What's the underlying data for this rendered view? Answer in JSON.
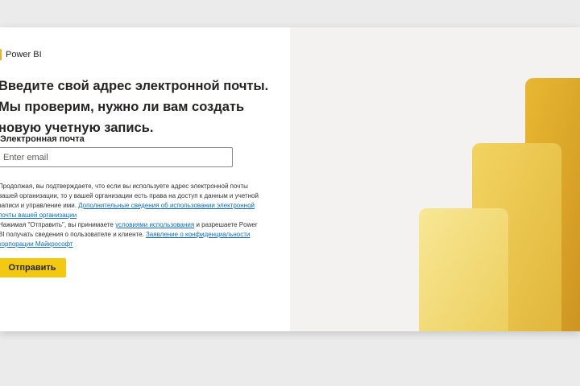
{
  "brand": {
    "name": "Power BI",
    "icon": "power-bi-logo-icon"
  },
  "form": {
    "headline": "Введите свой адрес электронной почты. Мы проверим, нужно ли вам создать новую учетную запись.",
    "email_label": "Электронная почта",
    "email_placeholder": "Enter email",
    "email_value": "",
    "consent_text_1": "Продолжая, вы подтверждаете, что если вы используете адрес электронной почты вашей организации, то у вашей организации есть права на доступ к данным и учетной записи и управление ими. ",
    "consent_link_1": "Дополнительные сведения об использовании электронной почты вашей организации",
    "consent_text_2": "Нажимая \"Отправить\", вы принимаете ",
    "terms_link": "условиями использования",
    "consent_text_3": " и разрешаете Power BI получать сведения о пользователе и клиенте. ",
    "privacy_link": "Заявление о конфиденциальности корпорации Майкрософт",
    "submit_label": "Отправить"
  },
  "colors": {
    "accent": "#f2c811",
    "link": "#0f6cbd",
    "right_panel": "#f3f2f1",
    "bar_back": "#e0a92a",
    "bar_middle": "#eccb52",
    "bar_front": "#f4df8a"
  }
}
